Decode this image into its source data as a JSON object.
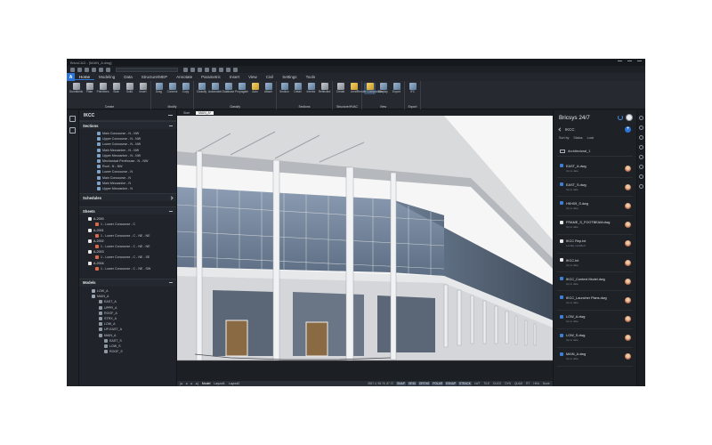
{
  "window": {
    "title": "BricsCAD - [MAIN_A.dwg]"
  },
  "menu": {
    "brand_letter": "A",
    "tabs": [
      "Home",
      "Modeling",
      "Data",
      "Structure/MEP",
      "Annotate",
      "Parametric",
      "Insert",
      "View",
      "Civil",
      "Settings",
      "Tools"
    ],
    "active_tab": "Home"
  },
  "ribbon": {
    "groups": [
      {
        "name": "Create",
        "items": [
          {
            "label": "Dumbbells",
            "color": "g"
          },
          {
            "label": "Plate",
            "color": "g"
          },
          {
            "label": "Primitives",
            "color": "g"
          },
          {
            "label": "Slab",
            "color": "g"
          },
          {
            "label": "Solid",
            "color": "g"
          },
          {
            "label": "Insert",
            "color": "g"
          }
        ]
      },
      {
        "name": "Modify",
        "items": [
          {
            "label": "Drag",
            "color": "b"
          },
          {
            "label": "Connect",
            "color": "b"
          },
          {
            "label": "Copy",
            "color": "b"
          }
        ]
      },
      {
        "name": "Classify",
        "items": [
          {
            "label": "Classify",
            "color": "b"
          },
          {
            "label": "Automatch",
            "color": "b"
          },
          {
            "label": "Database",
            "color": "b"
          },
          {
            "label": "Propagate",
            "color": "b"
          },
          {
            "label": "Auto",
            "color": "y"
          },
          {
            "label": "Attach",
            "color": "b"
          }
        ]
      },
      {
        "name": "Sections",
        "items": [
          {
            "label": "Section",
            "color": "b"
          },
          {
            "label": "Detail",
            "color": "b"
          },
          {
            "label": "Interior",
            "color": "b"
          },
          {
            "label": "Reflected",
            "color": "g"
          }
        ]
      },
      {
        "name": "Structure/HVAC",
        "items": [
          {
            "label": "Create",
            "color": "g"
          },
          {
            "label": "Level",
            "color": "y"
          }
        ]
      },
      {
        "name": "View",
        "items": [
          {
            "label": "Render Composition",
            "color": "y",
            "active": true
          },
          {
            "label": "Display",
            "color": "b"
          },
          {
            "label": "Export",
            "color": "b"
          }
        ]
      },
      {
        "name": "Export",
        "items": [
          {
            "label": "IFC",
            "color": "b"
          }
        ]
      }
    ]
  },
  "left_panel": {
    "title": "IKCC",
    "sections_title": "Sections",
    "sections": [
      "Main Concourse - N - NW",
      "Upper Concourse - N - NW",
      "Lower Concourse - N - NW",
      "Main Mezzanine - N - NW",
      "Upper Mezzanine - N - NW",
      "Mechanical Penthouse - N - NW",
      "Roof - N - NW",
      "Lower Concourse - N",
      "Main Concourse - N",
      "Main Mezzanine - N",
      "Upper Mezzanine - N"
    ],
    "schedules_title": "Schedules",
    "sheets_title": "Sheets",
    "sheets": [
      {
        "label": "A-2000",
        "type": "sheet"
      },
      {
        "label": "1 - Lower Concourse - C",
        "type": "sub"
      },
      {
        "label": "A-2001",
        "type": "sheet"
      },
      {
        "label": "1 - Lower Concourse - C - NE - NE",
        "type": "sub"
      },
      {
        "label": "A-2002",
        "type": "sheet"
      },
      {
        "label": "1 - Lower Concourse - C - NE - NE",
        "type": "sub"
      },
      {
        "label": "A-2003",
        "type": "sheet"
      },
      {
        "label": "1 - Lower Concourse - C - NE - SE",
        "type": "sub"
      },
      {
        "label": "A-2004",
        "type": "sheet"
      },
      {
        "label": "1 - Lower Concourse - C - NE - SW",
        "type": "sub"
      }
    ],
    "models_title": "Models",
    "models": [
      {
        "label": "LOW_A",
        "type": "model"
      },
      {
        "label": "MAIN_A",
        "type": "model"
      },
      {
        "label": "EAST_A",
        "type": "model2"
      },
      {
        "label": "UPPR_A",
        "type": "model2"
      },
      {
        "label": "ROOF_A",
        "type": "model2"
      },
      {
        "label": "STRX_A",
        "type": "model2"
      },
      {
        "label": "LOW_A",
        "type": "model2"
      },
      {
        "label": "UP-EAST_A",
        "type": "model2"
      },
      {
        "label": "MAIN_A",
        "type": "model2"
      },
      {
        "label": "EAST_S",
        "type": "model3"
      },
      {
        "label": "LOW_S",
        "type": "model3"
      },
      {
        "label": "ROOF_S",
        "type": "model3"
      }
    ]
  },
  "viewport": {
    "tabs": [
      "Start",
      "MAIN_A*"
    ],
    "active_tab": "MAIN_A*"
  },
  "layout_tabs": {
    "items": [
      "Model",
      "Layout1",
      "Layout2"
    ],
    "active": "Model"
  },
  "status": {
    "coords": "2837.4, 98.76, 87.37",
    "toggles": [
      "SNAP",
      "GRID",
      "ORTHO",
      "POLAR",
      "ESNAP",
      "STRACK",
      "LWT",
      "TILE",
      "DUCS",
      "DYN",
      "QUAD",
      "RT",
      "HKA",
      "None"
    ]
  },
  "right_panel": {
    "title": "Bricsys 24/7",
    "project": "IKCC",
    "sort_by": "Sort by",
    "sort_status": "Status",
    "sort_lock": "Lock",
    "folder": "Architectural_1",
    "files": [
      {
        "name": "EAST_A.dwg",
        "meta": "Up to date",
        "icon": "b"
      },
      {
        "name": "EAST_S.dwg",
        "meta": "Up to date",
        "icon": "b"
      },
      {
        "name": "HKH09_S.dwg",
        "meta": "Up to date",
        "icon": "b"
      },
      {
        "name": "FRAME_S_FOOTBEAM.dwg",
        "meta": "Up to date",
        "icon": "w"
      },
      {
        "name": "IKCC Rep.txt",
        "meta": "Locally modified",
        "icon": "w"
      },
      {
        "name": "IKCC.txt",
        "meta": "Up to date",
        "icon": "w"
      },
      {
        "name": "IKCC_Context Model.dwg",
        "meta": "Up to date",
        "icon": "b"
      },
      {
        "name": "IKCC_Launcher Plans.dwg",
        "meta": "Up to date",
        "icon": "b"
      },
      {
        "name": "LOW_A.dwg",
        "meta": "Up to date",
        "icon": "b"
      },
      {
        "name": "LOW_S.dwg",
        "meta": "Up to date",
        "icon": "b"
      },
      {
        "name": "MAIN_A.dwg",
        "meta": "Up to date",
        "icon": "b"
      }
    ]
  }
}
